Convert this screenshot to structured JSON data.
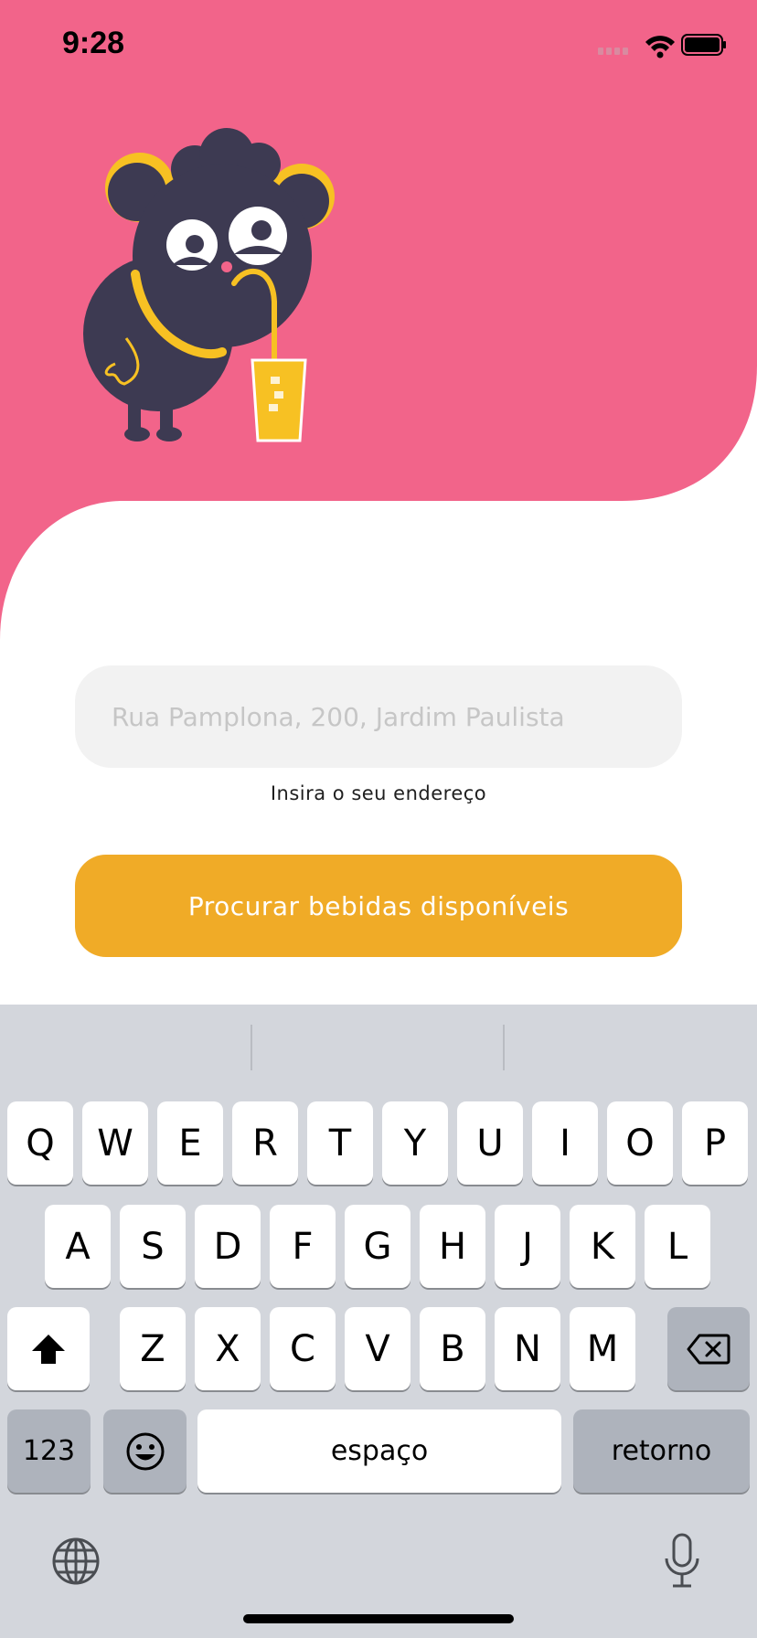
{
  "status_bar": {
    "time": "9:28"
  },
  "colors": {
    "hero_pink": "#f2648a",
    "mascot_navy": "#3d3a52",
    "accent_yellow": "#f7c123",
    "button_orange": "#f0ab27",
    "keyboard_bg": "#d3d6dc"
  },
  "form": {
    "address_placeholder": "Rua Pamplona, 200, Jardim Paulista",
    "address_value": "",
    "address_hint": "Insira o seu endereço",
    "search_button_label": "Procurar bebidas disponíveis"
  },
  "keyboard": {
    "row1": [
      "Q",
      "W",
      "E",
      "R",
      "T",
      "Y",
      "U",
      "I",
      "O",
      "P"
    ],
    "row2": [
      "A",
      "S",
      "D",
      "F",
      "G",
      "H",
      "J",
      "K",
      "L"
    ],
    "row3": [
      "Z",
      "X",
      "C",
      "V",
      "B",
      "N",
      "M"
    ],
    "numbers_label": "123",
    "space_label": "espaço",
    "return_label": "retorno",
    "icons": [
      "shift-icon",
      "backspace-icon",
      "emoji-icon",
      "globe-icon",
      "microphone-icon"
    ]
  }
}
